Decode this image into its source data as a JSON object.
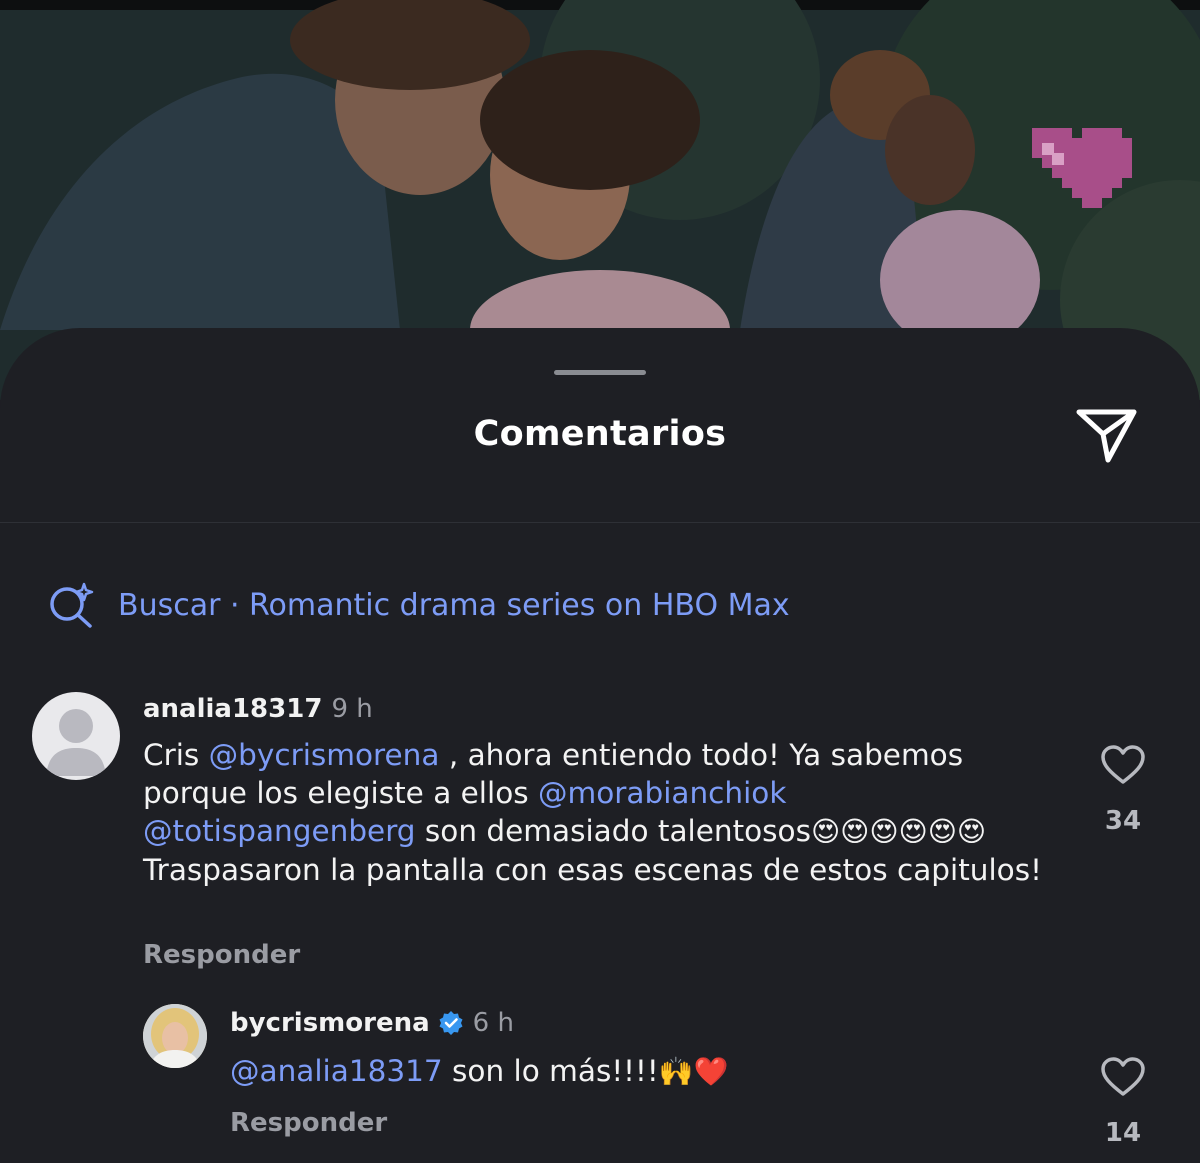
{
  "colors": {
    "sheet_bg": "#1e1f24",
    "accent_link": "#7d9cf6",
    "verified_blue": "#3897f0",
    "sticker_pink": "#c0529a"
  },
  "sheet": {
    "title": "Comentarios",
    "share_icon": "send-icon"
  },
  "search": {
    "icon": "ai-search-icon",
    "text": "Buscar · Romantic drama series on HBO Max"
  },
  "comments": [
    {
      "username": "analia18317",
      "time": "9 h",
      "avatar": "default-avatar-icon",
      "body": {
        "t1": "Cris ",
        "m1": "@bycrismorena",
        "t2": " , ahora entiendo todo! Ya sabemos porque los elegiste a ellos ",
        "m2": "@morabianchiok",
        "m3": "@totispangenberg",
        "t3": "  son demasiado talentosos",
        "e1": "😍😍😍😍😍😍",
        "t4": " Traspasaron la pantalla con esas escenas de estos capitulos!"
      },
      "reply_label": "Responder",
      "likes": "34"
    },
    {
      "username": "bycrismorena",
      "verified": true,
      "time": "6 h",
      "avatar": "profile-photo",
      "body": {
        "m1": "@analia18317",
        "t1": " son lo más!!!!",
        "e1": "🙌❤️"
      },
      "reply_label": "Responder",
      "likes": "14"
    }
  ]
}
